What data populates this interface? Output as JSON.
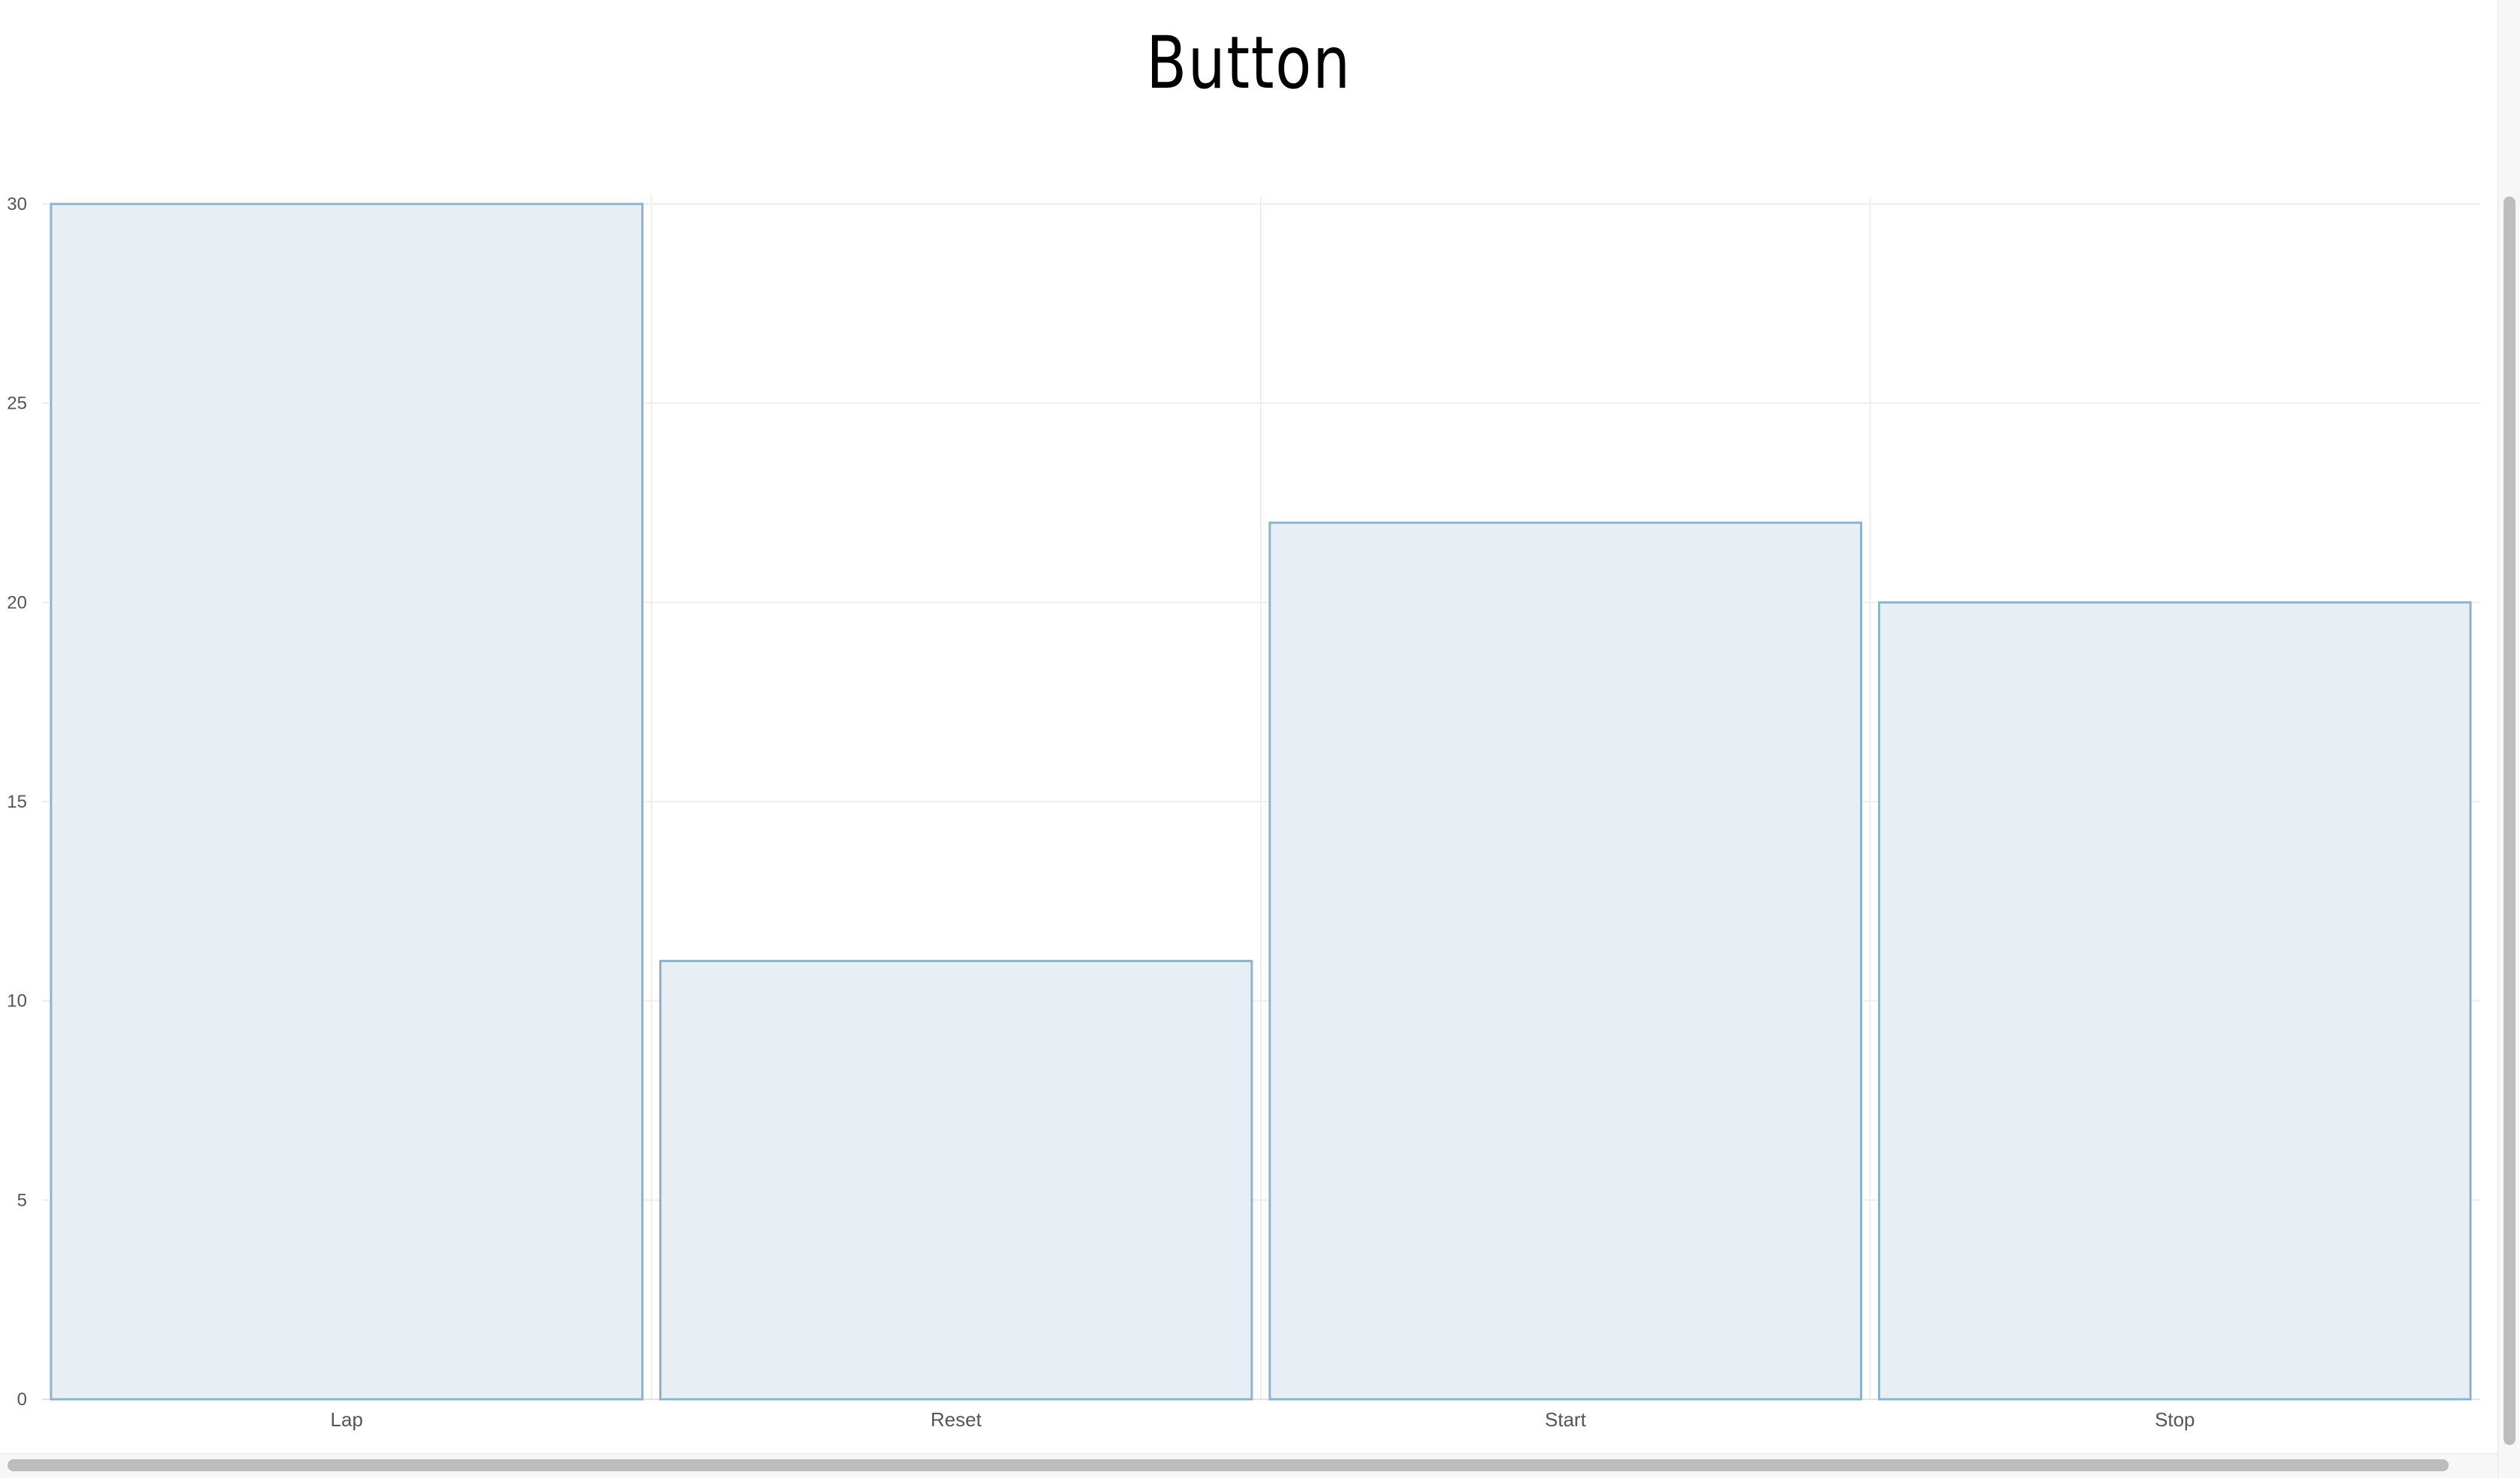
{
  "chart_data": {
    "type": "bar",
    "title": "Button",
    "categories": [
      "Lap",
      "Reset",
      "Start",
      "Stop"
    ],
    "values": [
      30,
      11,
      22,
      20
    ],
    "xlabel": "",
    "ylabel": "",
    "ylim": [
      0,
      30
    ],
    "yticks": [
      "0",
      "5",
      "10",
      "15",
      "20",
      "25",
      "30"
    ],
    "grid": true,
    "legend": "none",
    "colors": {
      "bar_fill": "#e7eff4",
      "bar_stroke": "#8cb4cf",
      "grid": "#eeeeee"
    }
  }
}
